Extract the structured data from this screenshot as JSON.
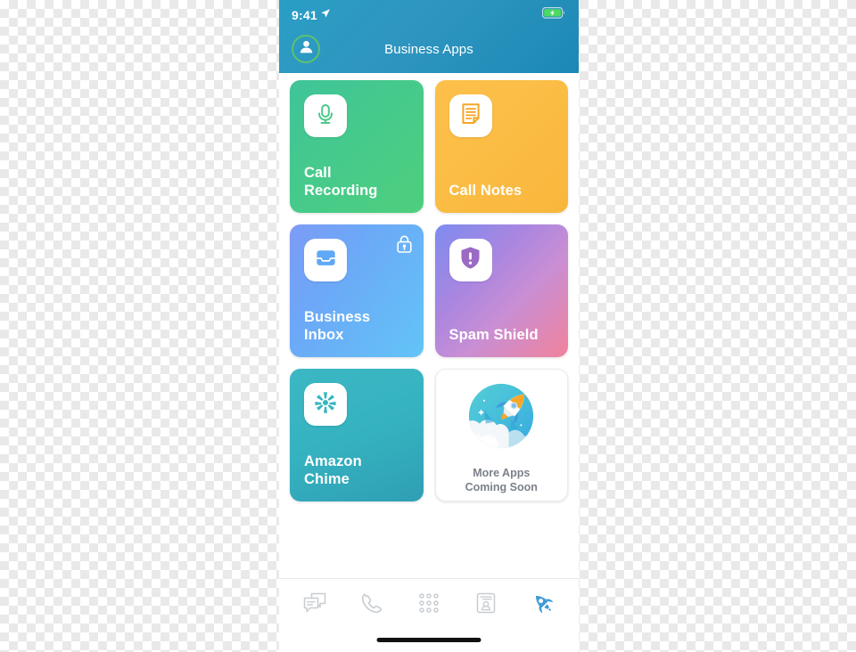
{
  "status_bar": {
    "time": "9:41",
    "location_icon": "location-arrow-icon",
    "battery_icon": "battery-charging-icon",
    "battery_color": "#4cd964"
  },
  "header": {
    "title": "Business Apps",
    "avatar_icon": "person-avatar-icon",
    "avatar_ring_color": "#5ec16f",
    "background_color": "#2a95be"
  },
  "apps": [
    {
      "label": "Call\nRecording",
      "icon": "microphone-icon",
      "icon_color": "#4bc98b",
      "gradient_from": "#3fc49a",
      "gradient_to": "#4ecf7d",
      "locked": false
    },
    {
      "label": "Call Notes",
      "icon": "document-note-icon",
      "icon_color": "#f5a623",
      "gradient_from": "#fcc04a",
      "gradient_to": "#f9b63c",
      "locked": false
    },
    {
      "label": "Business\nInbox",
      "icon": "inbox-tray-icon",
      "icon_color": "#61a8f6",
      "gradient_from": "#7d9bf5",
      "gradient_to": "#62c4f7",
      "locked": true,
      "lock_icon": "lock-icon"
    },
    {
      "label": "Spam Shield",
      "icon": "shield-alert-icon",
      "icon_color": "#9b6bc4",
      "gradient_from": "#7e8cf0",
      "gradient_to": "#f0839c",
      "locked": false
    },
    {
      "label": "Amazon\nChime",
      "icon": "amazon-chime-icon",
      "icon_color": "#35b5c2",
      "gradient_from": "#3cb7c4",
      "gradient_to": "#2f9fb4",
      "locked": false
    }
  ],
  "more_apps": {
    "label": "More Apps\nComing Soon",
    "illustration_icon": "rocket-planet-illustration",
    "text_color": "#7c8189"
  },
  "tab_bar": {
    "items": [
      {
        "icon": "messages-icon",
        "active": false
      },
      {
        "icon": "phone-icon",
        "active": false
      },
      {
        "icon": "keypad-icon",
        "active": false
      },
      {
        "icon": "contacts-icon",
        "active": false
      },
      {
        "icon": "rocket-icon",
        "active": true
      }
    ],
    "active_color": "#3d9bd6",
    "inactive_color": "#c8cdd2",
    "home_indicator": "home-indicator"
  }
}
